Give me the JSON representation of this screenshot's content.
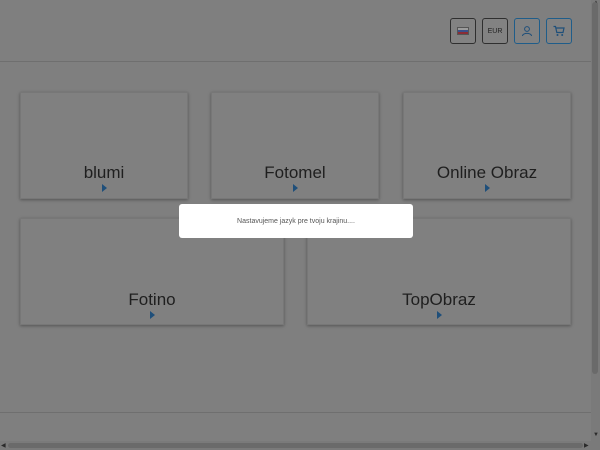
{
  "header": {
    "language_flag": "slovak-flag-icon",
    "currency": "EUR",
    "user_icon": "user-icon",
    "cart_icon": "cart-icon",
    "accent_color": "#1f5d8a"
  },
  "tiles": [
    {
      "label": "blumi"
    },
    {
      "label": "Fotomel"
    },
    {
      "label": "Online Obraz"
    },
    {
      "label": "Fotino"
    },
    {
      "label": "TopObraz"
    }
  ],
  "modal": {
    "message": "Nastavujeme jazyk pre tvoju krajinu...."
  }
}
